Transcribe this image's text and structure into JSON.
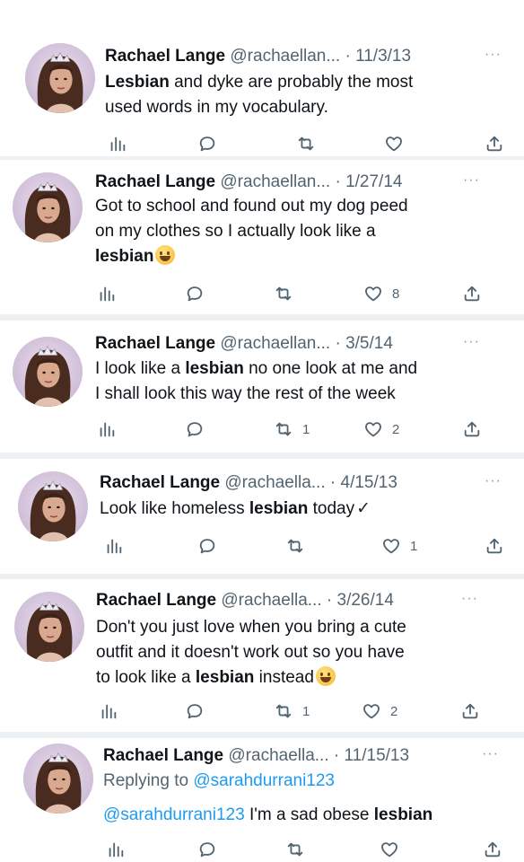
{
  "tweets": [
    {
      "name": "Rachael Lange",
      "meta": "@rachaellan... · 11/3/13",
      "body_parts": [
        [
          "Lesbian",
          true
        ],
        [
          " and dyke are probably the most\nused words in my vocabulary.",
          false
        ]
      ],
      "replying": null,
      "retweets": "",
      "likes": ""
    },
    {
      "name": "Rachael Lange",
      "meta": "@rachaellan... · 1/27/14",
      "body_parts": [
        [
          "Got to school and found out my dog peed\non my clothes so I actually look like a\n",
          false
        ],
        [
          "lesbian",
          true
        ]
      ],
      "emoji": true,
      "replying": null,
      "retweets": "",
      "likes": "8"
    },
    {
      "name": "Rachael Lange",
      "meta": "@rachaellan... · 3/5/14",
      "body_parts": [
        [
          "I look like a ",
          false
        ],
        [
          "lesbian",
          true
        ],
        [
          " no one look at me and\nI shall look this way the rest of the week",
          false
        ]
      ],
      "replying": null,
      "retweets": "1",
      "likes": "2"
    },
    {
      "name": "Rachael Lange",
      "meta": "@rachaella... · 4/15/13",
      "body_parts": [
        [
          "Look like homeless ",
          false
        ],
        [
          "lesbian",
          true
        ],
        [
          " today",
          false
        ]
      ],
      "check": "✓",
      "replying": null,
      "retweets": "",
      "likes": "1"
    },
    {
      "name": "Rachael Lange",
      "meta": "@rachaella... · 3/26/14",
      "body_parts": [
        [
          "Don't you just love when you bring a cute\noutfit and it doesn't work out so you have\nto look like a ",
          false
        ],
        [
          "lesbian",
          true
        ],
        [
          " instead",
          false
        ]
      ],
      "emoji": true,
      "replying": null,
      "retweets": "1",
      "likes": "2"
    },
    {
      "name": "Rachael Lange",
      "meta": "@rachaella... · 11/15/13",
      "replying_prefix": "Replying to ",
      "replying": "@sarahdurrani123",
      "mention": "@sarahdurrani123",
      "body_parts": [
        [
          " I'm a sad obese ",
          false
        ],
        [
          "lesbian",
          true
        ]
      ],
      "retweets": "",
      "likes": ""
    }
  ],
  "icons": [
    "views-icon",
    "reply-icon",
    "retweet-icon",
    "like-icon",
    "share-icon"
  ],
  "colors": {
    "text": "#0f1419",
    "secondary": "#536471",
    "link": "#1d9bf0",
    "separator": "#eef1f3"
  }
}
